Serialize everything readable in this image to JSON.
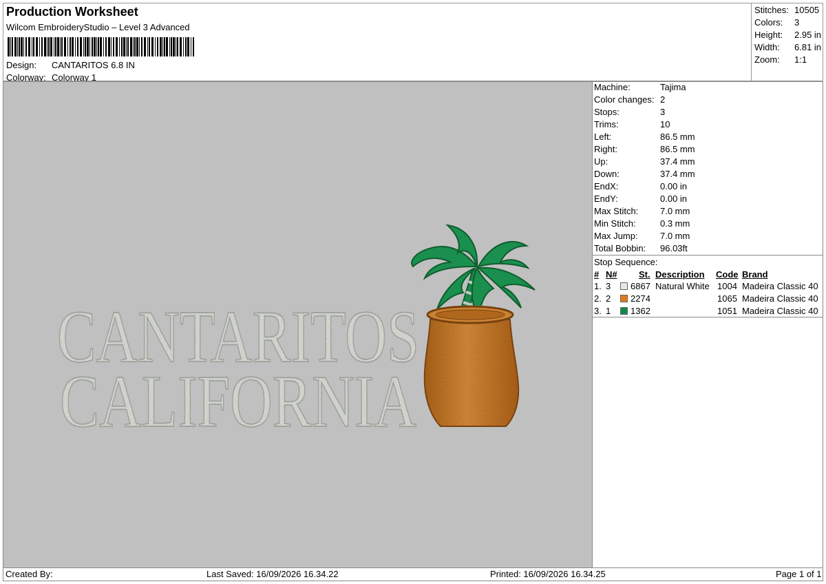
{
  "header": {
    "title": "Production Worksheet",
    "subtitle": "Wilcom EmbroideryStudio – Level 3 Advanced",
    "design_label": "Design:",
    "design_value": "CANTARITOS 6.8 IN",
    "colorway_label": "Colorway:",
    "colorway_value": "Colorway 1"
  },
  "summary": [
    {
      "label": "Stitches:",
      "value": "10505"
    },
    {
      "label": "Colors:",
      "value": "3"
    },
    {
      "label": "Height:",
      "value": "2.95 in"
    },
    {
      "label": "Width:",
      "value": "6.81 in"
    },
    {
      "label": "Zoom:",
      "value": "1:1"
    }
  ],
  "design_text": {
    "line1": "CANTARITOS",
    "line2": "CALIFORNIA"
  },
  "machine": [
    {
      "label": "Machine:",
      "value": "Tajima"
    },
    {
      "label": "Color changes:",
      "value": "2"
    },
    {
      "label": "Stops:",
      "value": "3"
    },
    {
      "label": "Trims:",
      "value": "10"
    },
    {
      "label": "Left:",
      "value": "86.5 mm"
    },
    {
      "label": "Right:",
      "value": "86.5 mm"
    },
    {
      "label": "Up:",
      "value": "37.4 mm"
    },
    {
      "label": "Down:",
      "value": "37.4 mm"
    },
    {
      "label": "EndX:",
      "value": "0.00 in"
    },
    {
      "label": "EndY:",
      "value": "0.00 in"
    },
    {
      "label": "Max Stitch:",
      "value": "7.0 mm"
    },
    {
      "label": "Min Stitch:",
      "value": "0.3 mm"
    },
    {
      "label": "Max Jump:",
      "value": "7.0 mm"
    },
    {
      "label": "Total Bobbin:",
      "value": "96.03ft"
    }
  ],
  "stop_sequence": {
    "title": "Stop Sequence:",
    "headers": {
      "hash": "#",
      "n": "N#",
      "st": "St.",
      "description": "Description",
      "code": "Code",
      "brand": "Brand"
    },
    "rows": [
      {
        "index": "1.",
        "n": "3",
        "color": "#e6e8e4",
        "st": "6867",
        "description": "Natural White",
        "code": "1004",
        "brand": "Madeira Classic 40"
      },
      {
        "index": "2.",
        "n": "2",
        "color": "#e07a1c",
        "st": "2274",
        "description": "",
        "code": "1065",
        "brand": "Madeira Classic 40"
      },
      {
        "index": "3.",
        "n": "1",
        "color": "#0f8a4a",
        "st": "1362",
        "description": "",
        "code": "1051",
        "brand": "Madeira Classic 40"
      }
    ]
  },
  "footer": {
    "created_by": "Created By:",
    "last_saved": "Last Saved: 16/09/2026 16.34.22",
    "printed": "Printed: 16/09/2026 16.34.25",
    "page": "Page 1 of 1"
  }
}
